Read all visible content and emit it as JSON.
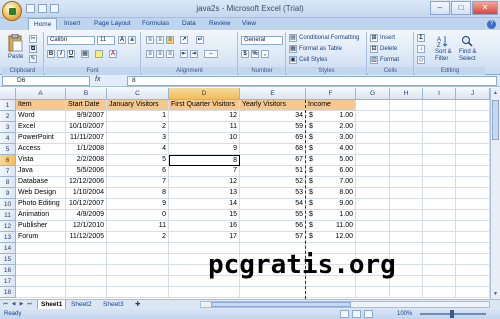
{
  "window": {
    "title": "java2s - Microsoft Excel (Trial)",
    "minimize": "–",
    "maximize": "□",
    "close": "✕"
  },
  "tabs": [
    "Home",
    "Insert",
    "Page Layout",
    "Formulas",
    "Data",
    "Review",
    "View"
  ],
  "ribbon": {
    "clipboard": {
      "label": "Clipboard",
      "paste": "Paste"
    },
    "font": {
      "label": "Font",
      "font_name": "Calibri",
      "font_size": "11",
      "bold": "B",
      "italic": "I",
      "underline": "U"
    },
    "alignment": {
      "label": "Alignment"
    },
    "number": {
      "label": "Number",
      "format": "General",
      "currency": "$",
      "percent": "%"
    },
    "styles": {
      "label": "Styles",
      "conditional": "Conditional Formatting",
      "format_table": "Format as Table",
      "cell_styles": "Cell Styles"
    },
    "cells": {
      "label": "Cells",
      "insert": "Insert",
      "delete": "Delete",
      "format": "Format"
    },
    "editing": {
      "label": "Editing",
      "sort": "Sort &",
      "filter": "Filter",
      "find": "Find &",
      "select": "Select"
    }
  },
  "formula_bar": {
    "name_box": "D6",
    "fx": "fx",
    "value": "8"
  },
  "columns": [
    "A",
    "B",
    "C",
    "D",
    "E",
    "F",
    "G",
    "H",
    "I",
    "J"
  ],
  "selected_column": "D",
  "selected_row": "6",
  "headers": [
    "Item",
    "Start Date",
    "January Visitors",
    "First Quarter Visitors",
    "Yearly Visitors",
    "Income"
  ],
  "rows": [
    [
      "Word",
      "9/9/2007",
      "1",
      "12",
      "34",
      "1.00"
    ],
    [
      "Excel",
      "10/10/2007",
      "2",
      "11",
      "59",
      "2.00"
    ],
    [
      "PowerPoint",
      "11/11/2007",
      "3",
      "10",
      "69",
      "3.00"
    ],
    [
      "Access",
      "1/1/2008",
      "4",
      "9",
      "68",
      "4.00"
    ],
    [
      "Vista",
      "2/2/2008",
      "5",
      "8",
      "67",
      "5.00"
    ],
    [
      "Java",
      "5/5/2006",
      "6",
      "7",
      "51",
      "6.00"
    ],
    [
      "Database",
      "12/12/2006",
      "7",
      "12",
      "52",
      "7.00"
    ],
    [
      "Web Design",
      "1/10/2004",
      "8",
      "13",
      "53",
      "8.00"
    ],
    [
      "Photo Editing",
      "10/12/2007",
      "9",
      "14",
      "54",
      "9.00"
    ],
    [
      "Animation",
      "4/9/2009",
      "0",
      "15",
      "55",
      "1.00"
    ],
    [
      "Publisher",
      "12/1/2010",
      "11",
      "16",
      "56",
      "11.00"
    ],
    [
      "Forum",
      "11/12/2005",
      "2",
      "17",
      "57",
      "12.00"
    ]
  ],
  "currency_symbol": "$",
  "row_numbers": [
    "1",
    "2",
    "3",
    "4",
    "5",
    "6",
    "7",
    "8",
    "9",
    "10",
    "11",
    "12",
    "13",
    "14",
    "15",
    "16",
    "17",
    "18"
  ],
  "sheet_tabs": [
    "Sheet1",
    "Sheet2",
    "Sheet3"
  ],
  "active_sheet": "Sheet1",
  "status": {
    "ready": "Ready",
    "zoom": "100%"
  },
  "watermark": "pcgratis.org",
  "colors": {
    "header_fill": "#f4c88e",
    "selection": "#f1bd5a",
    "ribbon": "#dde8f6"
  }
}
